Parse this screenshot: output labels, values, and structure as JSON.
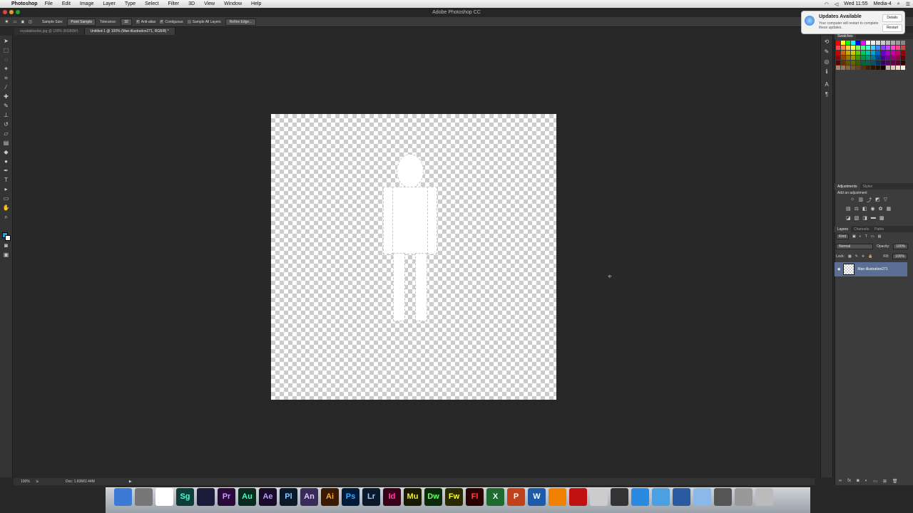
{
  "menubar": {
    "app": "Photoshop",
    "items": [
      "File",
      "Edit",
      "Image",
      "Layer",
      "Type",
      "Select",
      "Filter",
      "3D",
      "View",
      "Window",
      "Help"
    ],
    "clock": "Wed 11:55",
    "user": "Media-4"
  },
  "window_title": "Adobe Photoshop CC",
  "options": {
    "sample_size_label": "Sample Size:",
    "sample_size_value": "Point Sample",
    "tolerance_label": "Tolerance:",
    "tolerance_value": "32",
    "anti_alias": "Anti-alias",
    "contiguous": "Contiguous",
    "sample_all_layers": "Sample All Layers",
    "refine_edge": "Refine Edge..."
  },
  "tabs": [
    {
      "label": "royalabliss6ei.jpg @ 100% (RGB/8#)"
    },
    {
      "label": "Untitled-1 @ 100% (Man-illustration271, RGB/8) *"
    }
  ],
  "status": {
    "zoom": "100%",
    "doc": "Doc: 1.83M/2.44M"
  },
  "notification": {
    "title": "Updates Available",
    "body": "Your computer will restart to complete these updates.",
    "details": "Details",
    "restart": "Restart"
  },
  "panels": {
    "color_tab": "Swatches",
    "adjustments_tab": "Adjustments",
    "styles_tab": "Styles",
    "add_adjustment": "Add an adjustment",
    "layers_tab": "Layers",
    "channels_tab": "Channels",
    "paths_tab": "Paths",
    "kind": "Kind",
    "blend_mode": "Normal",
    "opacity_label": "Opacity:",
    "opacity_value": "100%",
    "lock_label": "Lock:",
    "fill_label": "Fill:",
    "fill_value": "100%",
    "layer_name": "Man-illustration271"
  },
  "colors": {
    "accent": "#1aa9e0",
    "layer_selected": "#5a6f93"
  },
  "dock": [
    {
      "label": "",
      "icon": "finder-icon",
      "bg": "#3b7bd6",
      "fg": "#fff"
    },
    {
      "label": "",
      "icon": "launchpad-icon",
      "bg": "#777",
      "fg": "#fff"
    },
    {
      "label": "",
      "icon": "acrobat-icon",
      "bg": "#fff",
      "fg": "#c00"
    },
    {
      "label": "Sg",
      "icon": "speedgrade-icon",
      "bg": "#0f3d3a",
      "fg": "#4fd"
    },
    {
      "label": "",
      "icon": "prelude-icon",
      "bg": "#1a1a3a",
      "fg": "#aaf"
    },
    {
      "label": "Pr",
      "icon": "premiere-icon",
      "bg": "#2a0a3a",
      "fg": "#c9f"
    },
    {
      "label": "Au",
      "icon": "audition-icon",
      "bg": "#0a2a20",
      "fg": "#4fb"
    },
    {
      "label": "Ae",
      "icon": "after-effects-icon",
      "bg": "#1a0a2a",
      "fg": "#b9f"
    },
    {
      "label": "Pl",
      "icon": "prelude-live-icon",
      "bg": "#0a1a2a",
      "fg": "#8cf"
    },
    {
      "label": "An",
      "icon": "animate-icon",
      "bg": "#3a2a5a",
      "fg": "#dcf"
    },
    {
      "label": "Ai",
      "icon": "illustrator-icon",
      "bg": "#3a1a00",
      "fg": "#fa3"
    },
    {
      "label": "Ps",
      "icon": "photoshop-icon",
      "bg": "#001a3a",
      "fg": "#3af"
    },
    {
      "label": "Lr",
      "icon": "lightroom-icon",
      "bg": "#0a1a2a",
      "fg": "#9cf"
    },
    {
      "label": "Id",
      "icon": "indesign-icon",
      "bg": "#3a001a",
      "fg": "#f4a"
    },
    {
      "label": "Mu",
      "icon": "muse-icon",
      "bg": "#1a1a00",
      "fg": "#ee3"
    },
    {
      "label": "Dw",
      "icon": "dreamweaver-icon",
      "bg": "#0a2a0a",
      "fg": "#6f6"
    },
    {
      "label": "Fw",
      "icon": "fireworks-icon",
      "bg": "#2a2a00",
      "fg": "#ff3"
    },
    {
      "label": "Fl",
      "icon": "flash-icon",
      "bg": "#2a0000",
      "fg": "#f44"
    },
    {
      "label": "X",
      "icon": "excel-icon",
      "bg": "#1d6b2e",
      "fg": "#fff"
    },
    {
      "label": "P",
      "icon": "powerpoint-icon",
      "bg": "#c0421d",
      "fg": "#fff"
    },
    {
      "label": "W",
      "icon": "word-icon",
      "bg": "#1f5aa8",
      "fg": "#fff"
    },
    {
      "label": "",
      "icon": "vlc-icon",
      "bg": "#f08000",
      "fg": "#fff"
    },
    {
      "label": "",
      "icon": "photo-booth-icon",
      "bg": "#c01010",
      "fg": "#fff"
    },
    {
      "label": "",
      "icon": "preview-icon",
      "bg": "#ccc",
      "fg": "#333"
    },
    {
      "label": "",
      "icon": "final-cut-icon",
      "bg": "#333",
      "fg": "#fff"
    },
    {
      "label": "",
      "icon": "itunes-icon",
      "bg": "#2a8ae0",
      "fg": "#fff"
    },
    {
      "label": "",
      "icon": "safari-icon",
      "bg": "#4aa0e0",
      "fg": "#fff"
    },
    {
      "label": "",
      "icon": "quicktime-icon",
      "bg": "#2a5aa0",
      "fg": "#fff"
    },
    {
      "label": "",
      "icon": "folder-icon",
      "bg": "#8ab8e8",
      "fg": "#fff"
    },
    {
      "label": "",
      "icon": "archive-icon",
      "bg": "#555",
      "fg": "#fff"
    },
    {
      "label": "",
      "icon": "downloads-icon",
      "bg": "#999",
      "fg": "#fff"
    },
    {
      "label": "",
      "icon": "trash-icon",
      "bg": "#bbb",
      "fg": "#555"
    }
  ]
}
